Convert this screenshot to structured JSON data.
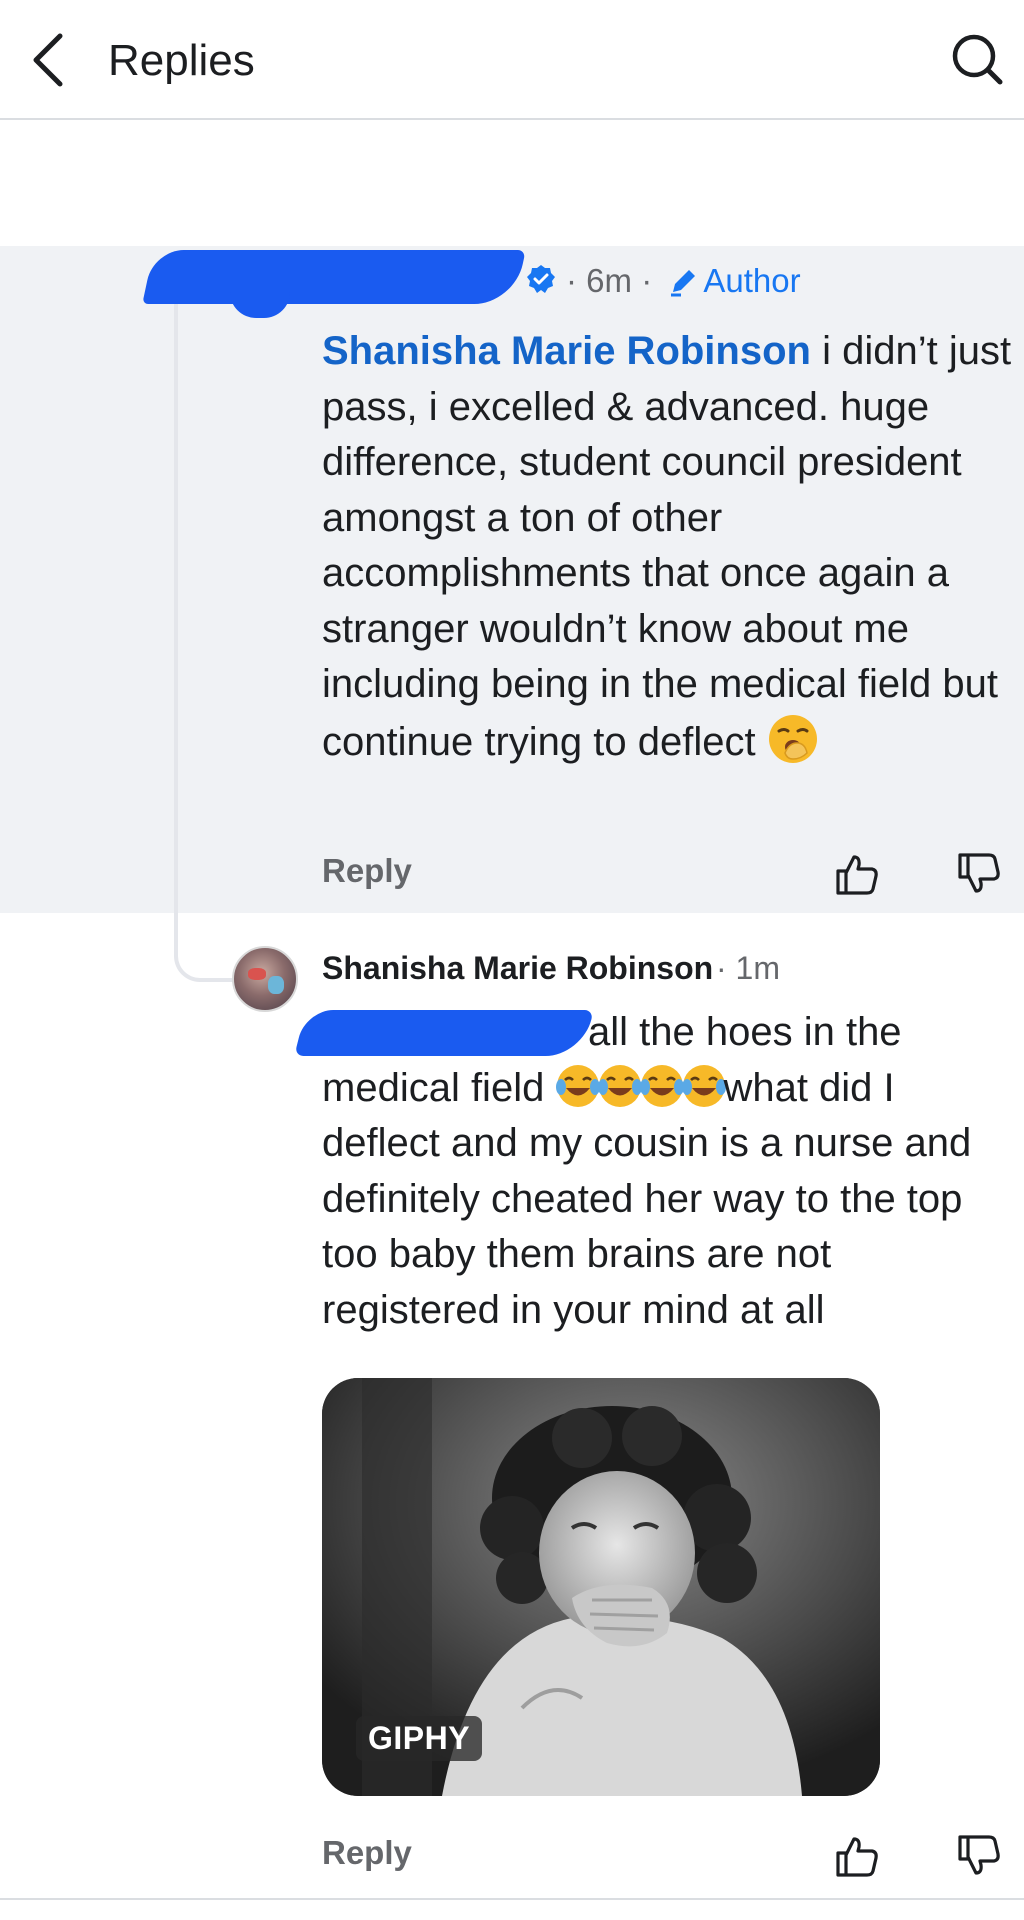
{
  "header": {
    "title": "Replies"
  },
  "author_comment": {
    "time": "6m",
    "author_badge": "Author",
    "mention": "Shanisha Marie Robinson",
    "text": " i didn’t just pass, i excelled & advanced. huge difference, student council president amongst a ton of other accomplishments that once again a stranger wouldn’t know about me including being in the medical field but continue trying to deflect ",
    "reply_label": "Reply"
  },
  "reply_comment": {
    "name": "Shanisha Marie Robinson",
    "time": "· 1m",
    "text_part1": "all the hoes in the medical field ",
    "text_part2": "what did I deflect and my cousin is a nurse and definitely cheated her way to the top too baby them brains are not registered in your mind at all",
    "gif_badge": "GIPHY",
    "reply_label": "Reply"
  },
  "colors": {
    "accent": "#1877f2",
    "redaction": "#1a5bf0",
    "highlight_bg": "#f0f2f5",
    "muted": "#65676b"
  },
  "icons": {
    "back": "chevron-left-icon",
    "search": "search-icon",
    "verified": "verified-badge-icon",
    "pencil": "pencil-icon",
    "like": "thumbs-up-icon",
    "dislike": "thumbs-down-icon"
  }
}
